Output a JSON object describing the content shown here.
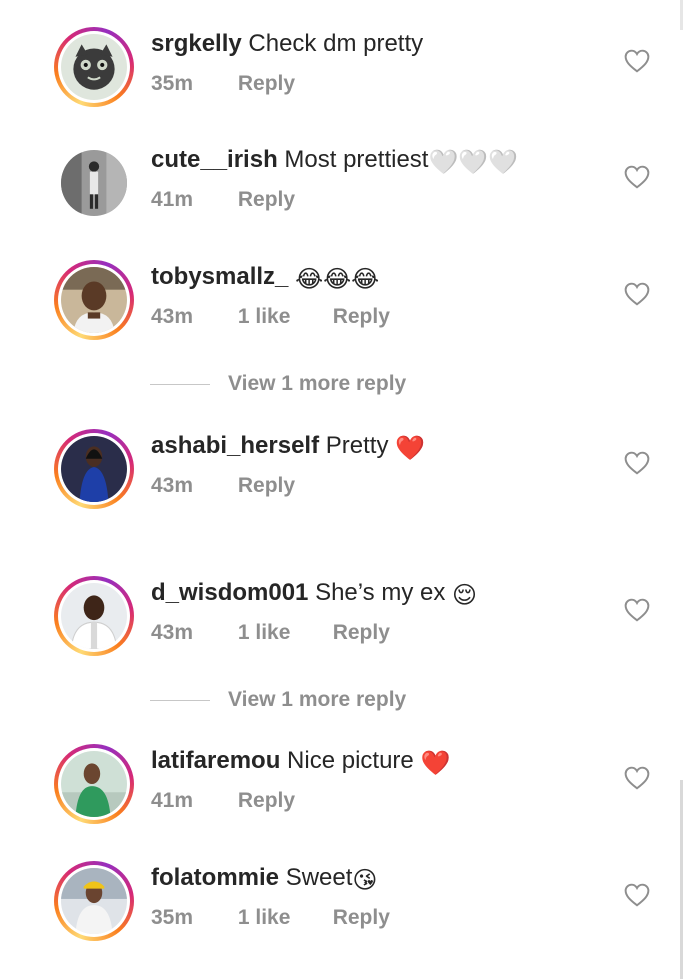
{
  "comments": [
    {
      "username": "srgkelly",
      "text": "Check dm pretty",
      "time": "35m",
      "likes": "",
      "reply": "Reply",
      "avatar": "cat-art-avatar",
      "story_ring": true
    },
    {
      "username": "cute__irish",
      "text": "Most prettiest",
      "emoji": "🤍🤍🤍",
      "time": "41m",
      "likes": "",
      "reply": "Reply",
      "avatar": "grey-photo-avatar",
      "story_ring": false
    },
    {
      "username": "tobysmallz_",
      "text": "",
      "emoji": "😂😂😂",
      "time": "43m",
      "likes": "1 like",
      "reply": "Reply",
      "avatar": "man-portrait-avatar",
      "story_ring": true
    },
    {
      "username": "ashabi_herself",
      "text": "Pretty",
      "emoji": "❤️",
      "time": "43m",
      "likes": "",
      "reply": "Reply",
      "avatar": "woman-blue-dress-avatar",
      "story_ring": true
    },
    {
      "username": "d_wisdom001",
      "text": "She’s my ex",
      "emoji": "😌",
      "time": "43m",
      "likes": "1 like",
      "reply": "Reply",
      "avatar": "man-white-shirt-avatar",
      "story_ring": true
    },
    {
      "username": "latifaremou",
      "text": "Nice picture",
      "emoji": "❤️",
      "time": "41m",
      "likes": "",
      "reply": "Reply",
      "avatar": "man-green-outfit-avatar",
      "story_ring": true
    },
    {
      "username": "folatommie",
      "text": "Sweet",
      "emoji": "😘",
      "time": "35m",
      "likes": "1 like",
      "reply": "Reply",
      "avatar": "man-cap-avatar",
      "story_ring": true
    }
  ],
  "view_more": {
    "after_tobysmallz": "View 1 more reply",
    "after_d_wisdom001": "View 1 more reply"
  },
  "colors": {
    "text": "#262626",
    "muted": "#8e8e8e",
    "heart_outline": "#8e8e8e"
  },
  "icons": {
    "like": "heart-outline-icon"
  }
}
